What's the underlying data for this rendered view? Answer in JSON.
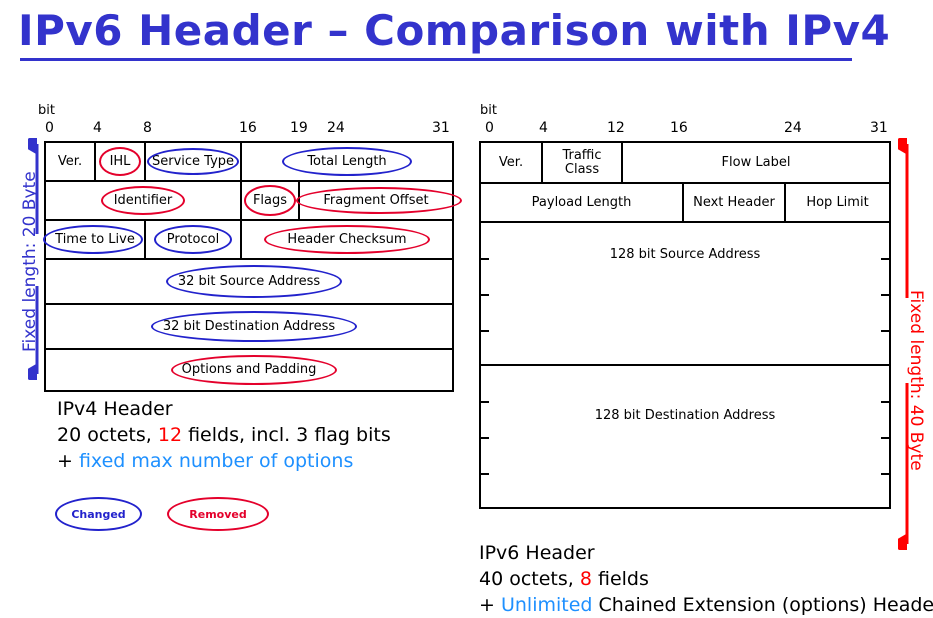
{
  "title": "IPv6 Header – Comparison with IPv4",
  "colors": {
    "title_blue": "#3333CC",
    "changed_blue": "#2222CC",
    "removed_red": "#E4002B",
    "accent_red": "#FF0000",
    "highlight_blue": "#1E90FF"
  },
  "ipv4": {
    "bit_word": "bit",
    "bit_ticks": [
      "0",
      "4",
      "8",
      "16",
      "19",
      "24",
      "31"
    ],
    "side_label": "Fixed length: 20 Byte",
    "rows": [
      {
        "cells": [
          {
            "label": "Ver.",
            "mark": "none"
          },
          {
            "label": "IHL",
            "mark": "removed"
          },
          {
            "label": "Service Type",
            "mark": "changed"
          },
          {
            "label": "Total Length",
            "mark": "changed"
          }
        ]
      },
      {
        "cells": [
          {
            "label": "Identifier",
            "mark": "removed"
          },
          {
            "label": "Flags",
            "mark": "removed"
          },
          {
            "label": "Fragment Offset",
            "mark": "removed"
          }
        ]
      },
      {
        "cells": [
          {
            "label": "Time to Live",
            "mark": "changed"
          },
          {
            "label": "Protocol",
            "mark": "changed"
          },
          {
            "label": "Header Checksum",
            "mark": "removed"
          }
        ]
      },
      {
        "cells": [
          {
            "label": "32 bit Source Address",
            "mark": "changed"
          }
        ]
      },
      {
        "cells": [
          {
            "label": "32 bit Destination Address",
            "mark": "changed"
          }
        ]
      },
      {
        "cells": [
          {
            "label": "Options and Padding",
            "mark": "removed"
          }
        ]
      }
    ],
    "caption": {
      "line1": "IPv4 Header",
      "line2_a": "20 octets, ",
      "line2_num": "12",
      "line2_b": " fields, incl. 3 flag bits",
      "line3_plus": "+ ",
      "line3_hl": "fixed max number of options"
    }
  },
  "ipv6": {
    "bit_word": "bit",
    "bit_ticks": [
      "0",
      "4",
      "12",
      "16",
      "24",
      "31"
    ],
    "side_label": "Fixed length: 40 Byte",
    "rows": [
      {
        "cells": [
          "Ver.",
          "Traffic\nClass",
          "Flow   Label"
        ]
      },
      {
        "cells": [
          "Payload Length",
          "Next Header",
          "Hop Limit"
        ]
      }
    ],
    "source_address": "128 bit Source Address",
    "destination_address": "128 bit Destination Address",
    "caption": {
      "line1": "IPv6 Header",
      "line2_a": "40 octets, ",
      "line2_num": "8",
      "line2_b": " fields",
      "line3_plus": "+ ",
      "line3_hl": "Unlimited",
      "line3_rest": " Chained Extension (options) Header"
    }
  },
  "legend": {
    "changed": "Changed",
    "removed": "Removed"
  }
}
